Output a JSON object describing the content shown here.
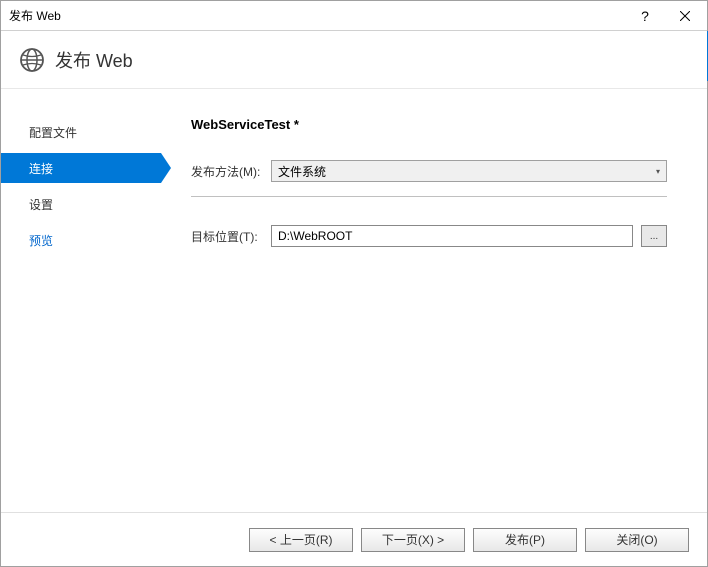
{
  "titlebar": {
    "title": "发布 Web",
    "help": "?"
  },
  "header": {
    "title": "发布 Web"
  },
  "sidebar": {
    "items": [
      {
        "label": "配置文件"
      },
      {
        "label": "连接"
      },
      {
        "label": "设置"
      },
      {
        "label": "预览"
      }
    ]
  },
  "main": {
    "profile_name": "WebServiceTest *",
    "method_label": "发布方法(M):",
    "method_value": "文件系统",
    "target_label": "目标位置(T):",
    "target_value": "D:\\WebROOT",
    "browse_label": "..."
  },
  "footer": {
    "prev": "< 上一页(R)",
    "next": "下一页(X) >",
    "publish": "发布(P)",
    "close": "关闭(O)"
  }
}
